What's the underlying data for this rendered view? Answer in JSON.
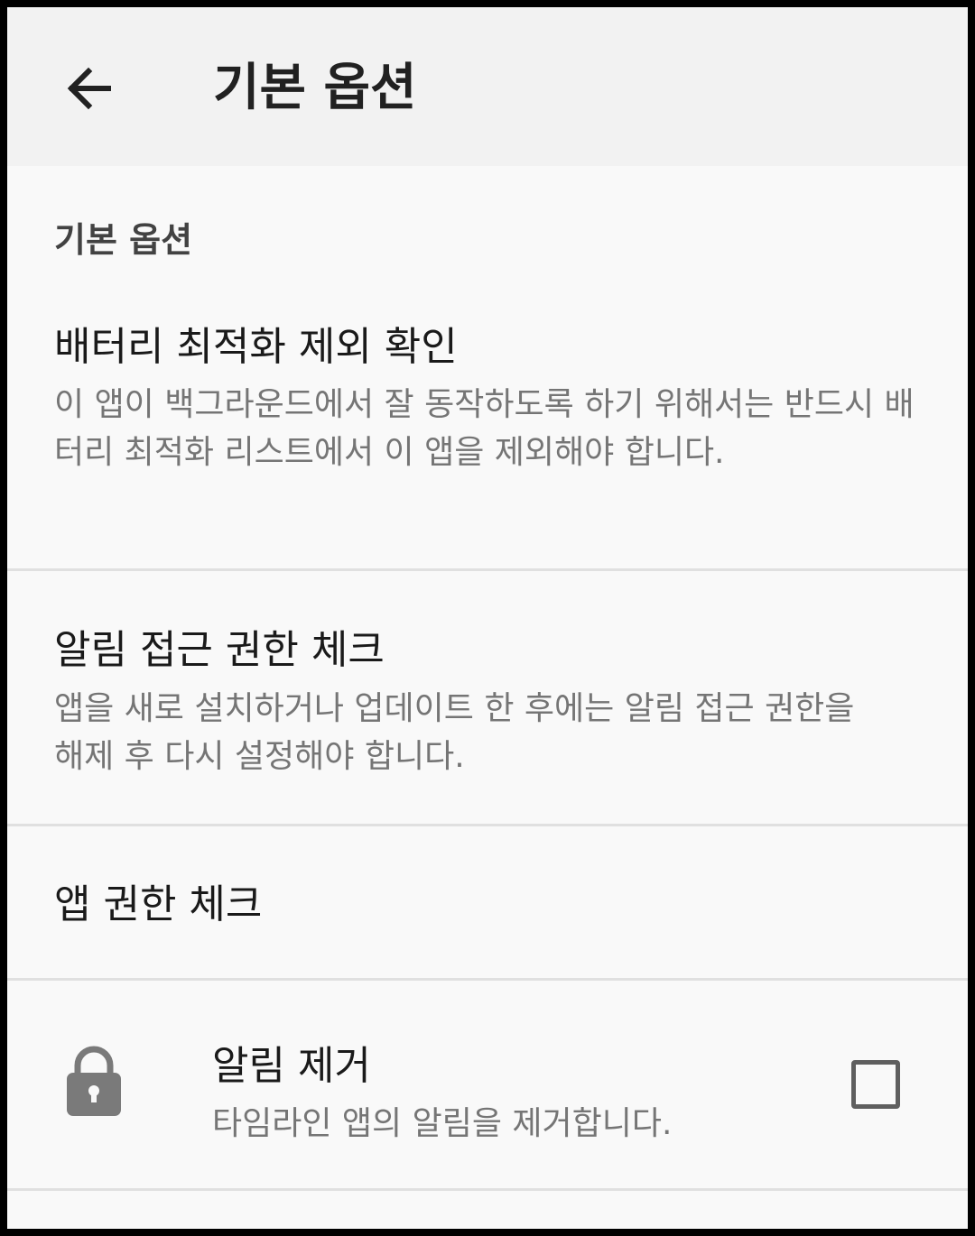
{
  "appbar": {
    "title": "기본 옵션",
    "back_icon": "arrow-left-icon"
  },
  "section": {
    "header": "기본 옵션"
  },
  "prefs": [
    {
      "title": "배터리 최적화 제외 확인",
      "summary": "이 앱이 백그라운드에서 잘 동작하도록 하기 위해서는 반드시 배터리 최적화 리스트에서 이 앱을 제외해야 합니다."
    },
    {
      "title": "알림 접근 권한 체크",
      "summary": "앱을 새로 설치하거나 업데이트 한 후에는 알림 접근 권한을 해제 후 다시 설정해야 합니다."
    },
    {
      "title": "앱 권한 체크",
      "summary": ""
    },
    {
      "title": "알림 제거",
      "summary": "타임라인 앱의 알림을 제거합니다.",
      "icon": "lock-icon",
      "checked": false
    }
  ],
  "colors": {
    "appbar_bg": "#f2f2f2",
    "screen_bg": "#f9f9f9",
    "title_text": "#1a1a1a",
    "summary_text": "#757575",
    "icon_gray": "#7a7a7a"
  }
}
